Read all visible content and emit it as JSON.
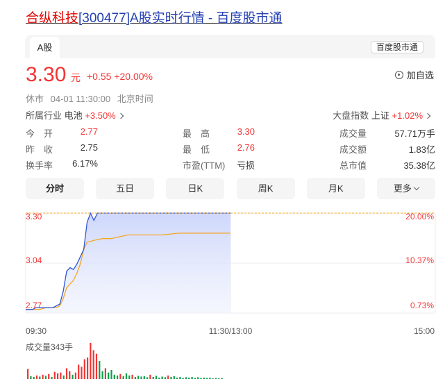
{
  "title": {
    "highlight": "合纵科技",
    "rest": "[300477]A股实时行情 - 百度股市通"
  },
  "tabs": {
    "active": "A股",
    "source": "百度股市通"
  },
  "quote": {
    "price": "3.30",
    "unit": "元",
    "change": "+0.55",
    "change_pct": "+20.00%",
    "watch_label": "加自选",
    "status": "休市",
    "datetime": "04-01 11:30:00",
    "timezone": "北京时间"
  },
  "industry": {
    "label": "所属行业",
    "name": "电池",
    "change": "+3.50%"
  },
  "market": {
    "label": "大盘指数",
    "name": "上证",
    "change": "+1.02%"
  },
  "stats": [
    [
      {
        "label": "今　开",
        "value": "2.77",
        "tone": "red"
      },
      {
        "label": "最　高",
        "value": "3.30",
        "tone": "red"
      },
      {
        "label": "成交量",
        "value": "57.71万手"
      }
    ],
    [
      {
        "label": "昨　收",
        "value": "2.75",
        "tone": "dark"
      },
      {
        "label": "最　低",
        "value": "2.76",
        "tone": "red"
      },
      {
        "label": "成交额",
        "value": "1.83亿"
      }
    ],
    [
      {
        "label": "换手率",
        "value": "6.17%",
        "tone": "dark"
      },
      {
        "label": "市盈(TTM)",
        "value": "亏损",
        "tone": "dark"
      },
      {
        "label": "总市值",
        "value": "35.38亿"
      }
    ]
  ],
  "periods": [
    "分时",
    "五日",
    "日K",
    "周K",
    "月K",
    "更多"
  ],
  "colors": {
    "up": "#f23535",
    "price_line": "#2f57d4",
    "avg_line": "#f5a623",
    "volume_up": "#f23535",
    "volume_down": "#0aa04a"
  },
  "chart_data": {
    "type": "line",
    "price_axis": [
      3.3,
      3.04,
      2.77
    ],
    "price_axis_labels": [
      "3.30",
      "3.04",
      "2.77"
    ],
    "pct_axis_labels": [
      "20.00%",
      "10.37%",
      "0.73%"
    ],
    "time_labels": [
      "09:30",
      "11:30/13:00",
      "15:00"
    ],
    "ylim": [
      2.75,
      3.3
    ],
    "minutes_total": 240,
    "series": [
      {
        "x": [
          0,
          2,
          4,
          6,
          8,
          10,
          12,
          14,
          16,
          18,
          20,
          22,
          24,
          26,
          28,
          30,
          32,
          34,
          36,
          38,
          40,
          42,
          45,
          50,
          55,
          60,
          70,
          80,
          90,
          100,
          110,
          120
        ],
        "y": [
          2.77,
          2.77,
          2.77,
          2.78,
          2.78,
          2.78,
          2.78,
          2.78,
          2.78,
          2.79,
          2.8,
          2.87,
          2.98,
          3.0,
          2.99,
          3.02,
          3.06,
          3.1,
          3.25,
          3.3,
          3.26,
          3.3,
          3.3,
          3.3,
          3.3,
          3.3,
          3.3,
          3.3,
          3.3,
          3.3,
          3.3,
          3.3
        ]
      },
      {
        "x": [
          0,
          4,
          8,
          12,
          16,
          18,
          20,
          22,
          24,
          26,
          28,
          30,
          32,
          34,
          36,
          40,
          45,
          50,
          60,
          70,
          80,
          90,
          100,
          110,
          120
        ],
        "y": [
          2.77,
          2.77,
          2.77,
          2.78,
          2.78,
          2.78,
          2.79,
          2.83,
          2.89,
          2.91,
          2.93,
          2.97,
          3.02,
          3.1,
          3.14,
          3.15,
          3.16,
          3.16,
          3.18,
          3.18,
          3.18,
          3.19,
          3.19,
          3.19,
          3.19
        ]
      }
    ],
    "volume": {
      "label": "成交量343手",
      "values": [
        28,
        8,
        6,
        10,
        7,
        12,
        9,
        14,
        6,
        20,
        16,
        18,
        10,
        30,
        22,
        12,
        18,
        40,
        34,
        55,
        60,
        100,
        80,
        70,
        50,
        22,
        30,
        18,
        25,
        12,
        10,
        14,
        8,
        16,
        10,
        12,
        6,
        9,
        7,
        8,
        5,
        12,
        6,
        9,
        4,
        7,
        5,
        10,
        6,
        8,
        4,
        6,
        3,
        5,
        4,
        6,
        3,
        5,
        3,
        4,
        3,
        4,
        2,
        3,
        2,
        3
      ],
      "up": [
        1,
        0,
        0,
        1,
        0,
        1,
        0,
        1,
        0,
        1,
        1,
        1,
        0,
        1,
        1,
        0,
        1,
        1,
        1,
        1,
        1,
        1,
        1,
        1,
        0,
        0,
        1,
        0,
        0,
        0,
        0,
        1,
        0,
        0,
        0,
        1,
        0,
        0,
        0,
        0,
        0,
        1,
        0,
        0,
        0,
        0,
        0,
        1,
        0,
        0,
        0,
        0,
        0,
        0,
        0,
        0,
        0,
        0,
        0,
        0,
        0,
        0,
        0,
        0,
        0,
        0
      ]
    }
  }
}
